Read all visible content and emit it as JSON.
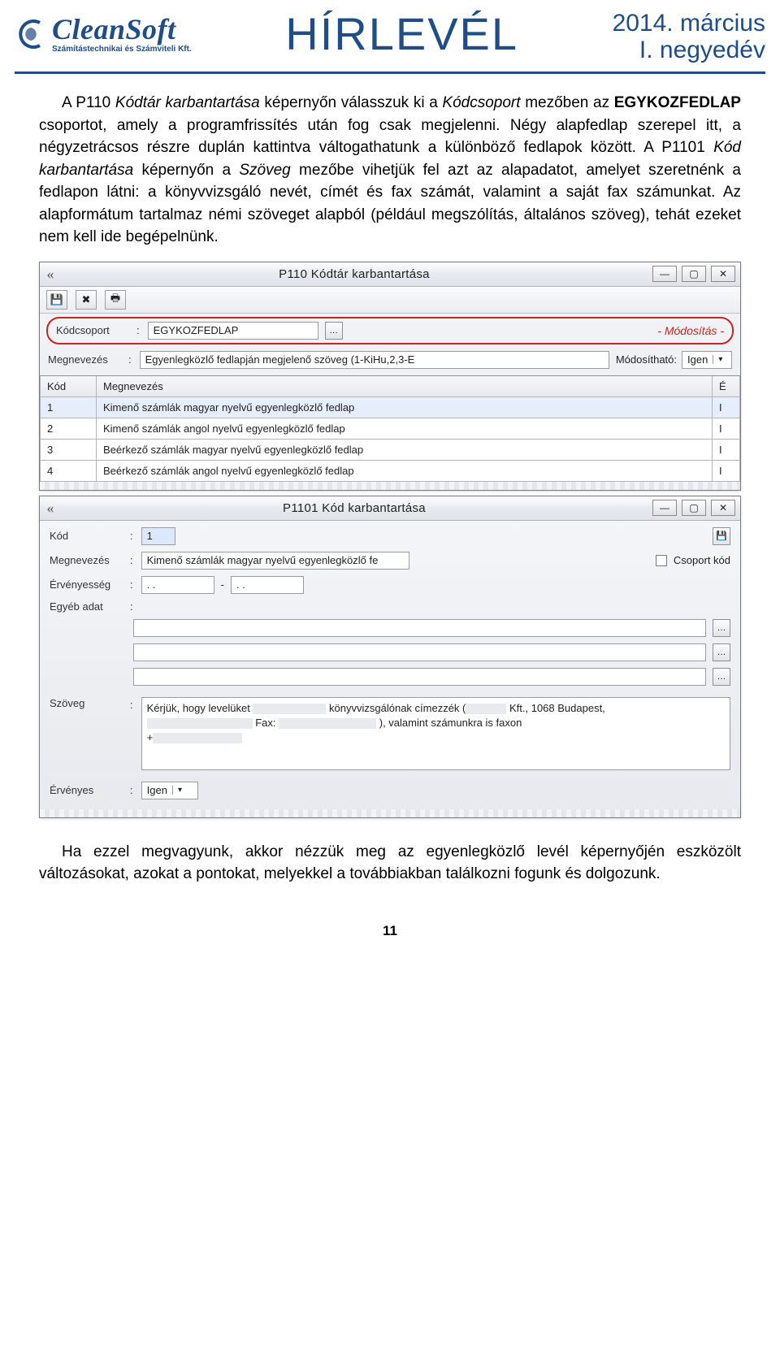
{
  "header": {
    "logo_title": "CleanSoft",
    "logo_sub": "Számítástechnikai és Számviteli Kft.",
    "main_title": "HÍRLEVÉL",
    "issue_line1": "2014. március",
    "issue_line2": "I. negyedév"
  },
  "para1": {
    "t1": "A P110 ",
    "t2": "Kódtár karbantartása",
    "t3": " képernyőn válasszuk ki a ",
    "t4": "Kódcsoport",
    "t5": " mezőben az ",
    "t6": "EGYKOZFEDLAP",
    "t7": " csoportot, amely a programfrissítés után fog csak megjelenni. Négy alapfedlap szerepel itt, a négyzetrácsos részre duplán kattintva váltogathatunk a különböző fedlapok között. A P1101 ",
    "t8": "Kód karbantartása",
    "t9": " képernyőn a ",
    "t10": "Szöveg",
    "t11": " mezőbe vihetjük fel azt az alapadatot, amelyet szeretnénk a fedlapon látni: a könyvvizsgáló nevét, címét és fax számát, valamint a saját fax számunkat. Az alapformátum tartalmaz némi szöveget alapból (például megszólítás, általános szöveg), tehát ezeket nem kell ide begépelnünk."
  },
  "win1": {
    "title": "P110 Kódtár karbantartása",
    "lbl_kodcsoport": "Kódcsoport",
    "val_kodcsoport": "EGYKOZFEDLAP",
    "status_mod": "- Módosítás -",
    "lbl_megnev": "Megnevezés",
    "val_megnev": "Egyenlegközlő fedlapján megjelenő szöveg (1-KiHu,2,3-E",
    "lbl_modosithato": "Módosítható:",
    "val_modosithato": "Igen",
    "col_kod": "Kód",
    "col_megnev": "Megnevezés",
    "col_e": "É",
    "rows": [
      {
        "kod": "1",
        "megnev": "Kimenő számlák magyar nyelvű egyenlegközlő fedlap",
        "e": "I"
      },
      {
        "kod": "2",
        "megnev": "Kimenő számlák angol nyelvű egyenlegközlő fedlap",
        "e": "I"
      },
      {
        "kod": "3",
        "megnev": "Beérkező számlák magyar nyelvű egyenlegközlő fedlap",
        "e": "I"
      },
      {
        "kod": "4",
        "megnev": "Beérkező számlák angol nyelvű egyenlegközlő fedlap",
        "e": "I"
      }
    ]
  },
  "win2": {
    "title": "P1101 Kód karbantartása",
    "lbl_kod": "Kód",
    "val_kod": "1",
    "lbl_megnev": "Megnevezés",
    "val_megnev": "Kimenő számlák magyar nyelvű egyenlegközlő fe",
    "lbl_csoportkod": "Csoport kód",
    "lbl_ervenyesseg": "Érvényesség",
    "val_erv1": ". .",
    "val_erv_sep": "-",
    "val_erv2": ". .",
    "lbl_egyeb": "Egyéb adat",
    "lbl_szoveg": "Szöveg",
    "szoveg_part1": "Kérjük, hogy levelüket ",
    "szoveg_part2": " könyvvizsgálónak címezzék (",
    "szoveg_part3": " Kft., 1068 Budapest, ",
    "szoveg_part4": "            Fax: ",
    "szoveg_part5": " ), valamint számunkra is faxon ",
    "szoveg_part6": "+",
    "lbl_ervenyes": "Érvényes",
    "val_ervenyes": "Igen"
  },
  "para2": "Ha ezzel megvagyunk, akkor nézzük meg az egyenlegközlő levél képernyőjén eszközölt változásokat, azokat a pontokat, melyekkel a továbbiakban találkozni fogunk és dolgozunk.",
  "page_number": "11"
}
